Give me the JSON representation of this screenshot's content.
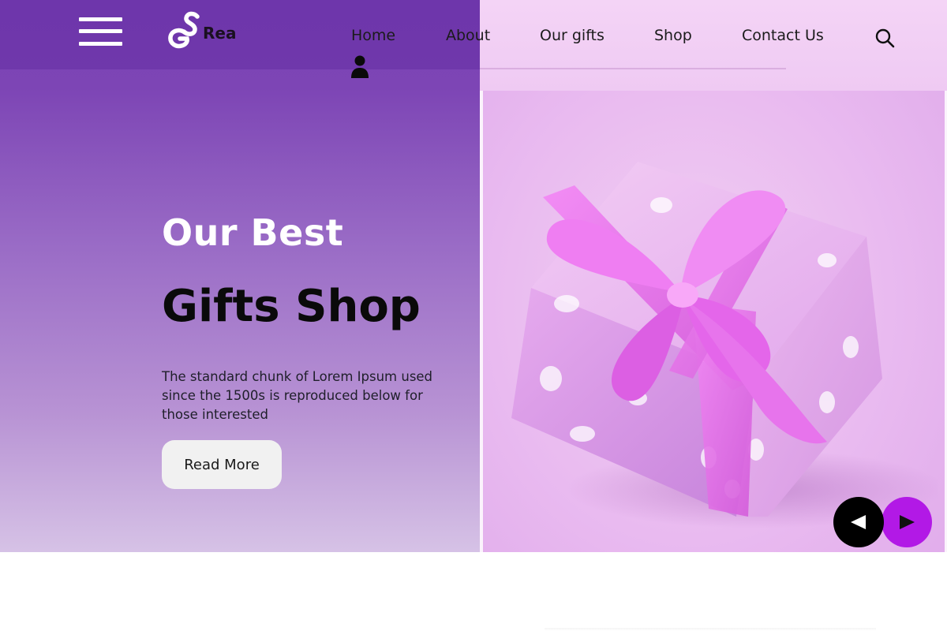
{
  "brand": {
    "logo_text": "Rea",
    "logo_icon": "gs-monogram-icon"
  },
  "nav": {
    "items": [
      {
        "label": "Home"
      },
      {
        "label": "About"
      },
      {
        "label": "Our gifts"
      },
      {
        "label": "Shop"
      },
      {
        "label": "Contact Us"
      }
    ],
    "search_icon": "search-icon",
    "user_icon": "user-icon",
    "menu_icon": "hamburger-menu-icon"
  },
  "hero": {
    "kicker": "Our Best",
    "title": "Gifts Shop",
    "description": "The standard chunk of Lorem Ipsum used since the 1500s is reproduced below for those interested",
    "cta_label": "Read More",
    "image": "gift-box-image"
  },
  "slider": {
    "prev_icon": "arrow-left-icon",
    "next_icon": "arrow-right-icon"
  },
  "colors": {
    "hero_purple": "#7b43b4",
    "hero_pink": "#eec6f2",
    "accent_magenta": "#b219e6",
    "button_bg": "#f1f1f1",
    "text_dark": "#0a0a0a"
  }
}
